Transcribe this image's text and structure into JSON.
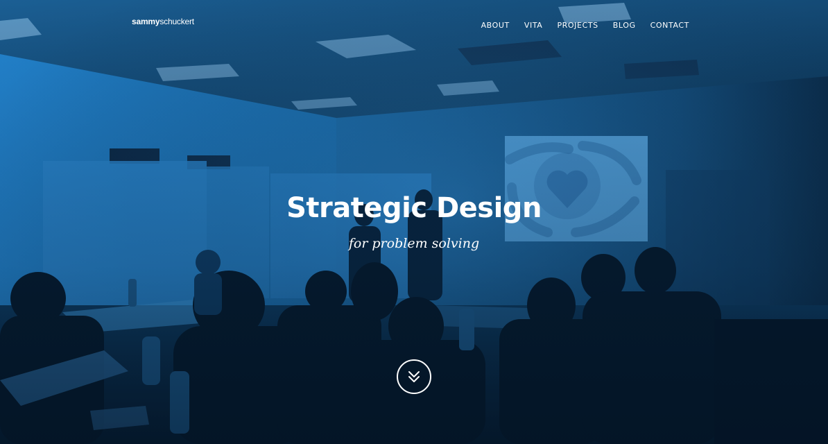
{
  "site": {
    "logo_bold": "sammy",
    "logo_light": "schuckert"
  },
  "nav": {
    "items": [
      {
        "label": "ABOUT"
      },
      {
        "label": "VITA"
      },
      {
        "label": "PROJECTS"
      },
      {
        "label": "BLOG"
      },
      {
        "label": "CONTACT"
      }
    ]
  },
  "hero": {
    "title": "Strategic Design",
    "subtitle": "for problem solving",
    "scroll_icon": "double-chevron-down-icon"
  },
  "colors": {
    "tint": "#1a6aa8",
    "text": "#ffffff",
    "dark": "#06203a"
  }
}
